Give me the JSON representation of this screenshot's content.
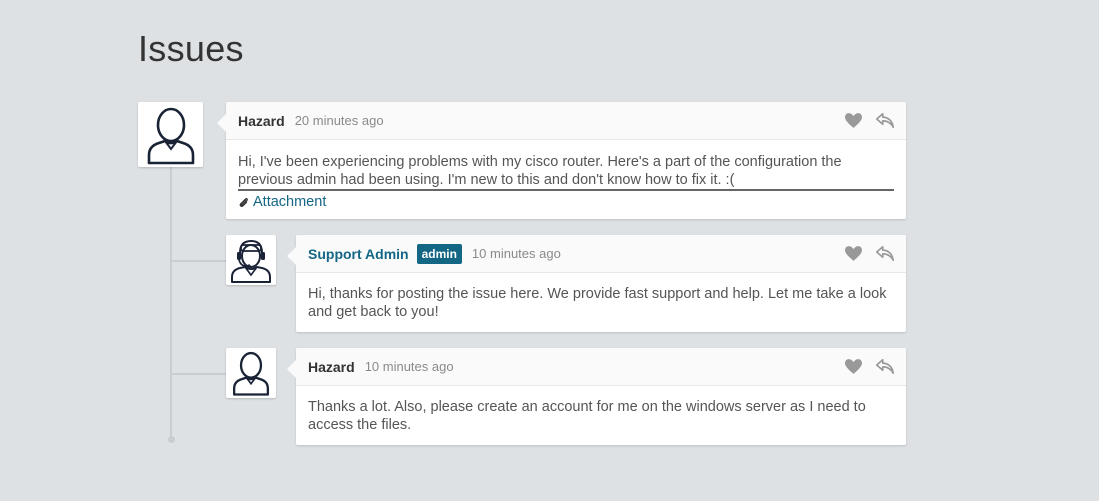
{
  "page": {
    "title": "Issues"
  },
  "comments": [
    {
      "author": "Hazard",
      "time": "20 minutes ago",
      "text": "Hi, I've been experiencing problems with my cisco router. Here's a part of the configuration the previous admin had been using. I'm new to this and don't know how to fix it. :(",
      "attachment": "Attachment",
      "avatar_icon": "user-icon"
    },
    {
      "author": "Support Admin",
      "badge": "admin",
      "time": "10 minutes ago",
      "text": "Hi, thanks for posting the issue here. We provide fast support and help. Let me take a look and get back to you!",
      "avatar_icon": "support-agent-icon"
    },
    {
      "author": "Hazard",
      "time": "10 minutes ago",
      "text": "Thanks a lot. Also, please create an account for me on the windows server as I need to access the files.",
      "avatar_icon": "user-icon"
    }
  ],
  "colors": {
    "background": "#dee1e4",
    "accent": "#146685",
    "icon": "#999999"
  }
}
